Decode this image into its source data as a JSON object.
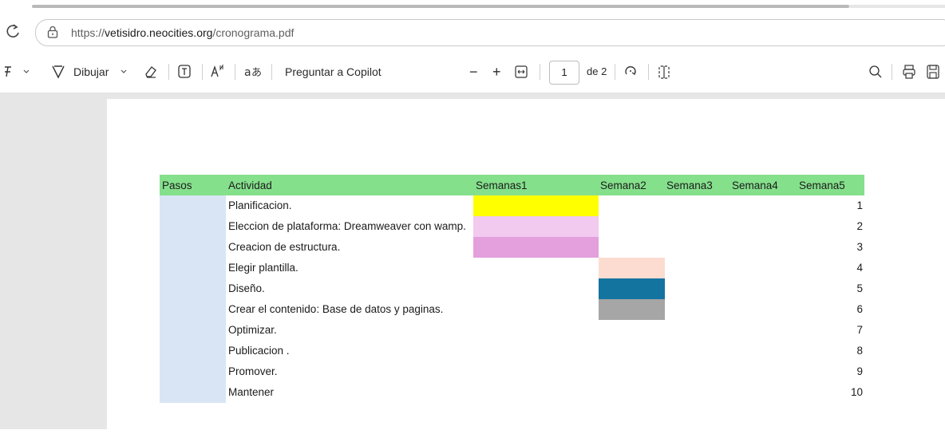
{
  "browser": {
    "url_prefix": "https://",
    "url_host": "vetisidro.neocities.org",
    "url_path": "/cronograma.pdf"
  },
  "toolbar": {
    "draw_label": "Dibujar",
    "copilot_label": "Preguntar a Copilot",
    "zoom_out": "−",
    "zoom_in": "+",
    "current_page": "1",
    "of_pages": "de 2"
  },
  "table": {
    "headers": {
      "steps": "Pasos",
      "activity": "Actividad",
      "week1": "Semanas1",
      "week2": "Semana2",
      "week3": "Semana3",
      "week4": "Semana4",
      "week5": "Semana5"
    },
    "rows": [
      {
        "n": "1",
        "activity": "Planificacion.",
        "bar_week": 1,
        "bar_color": "#ffff00"
      },
      {
        "n": "2",
        "activity": " Eleccion de plataforma: Dreamweaver con wamp.",
        "bar_week": 1,
        "bar_color": "#f2c9ef"
      },
      {
        "n": "3",
        "activity": "Creacion de estructura.",
        "bar_week": 1,
        "bar_color": "#e3a0dc"
      },
      {
        "n": "4",
        "activity": "Elegir plantilla.",
        "bar_week": 2,
        "bar_color": "#fcdcd0"
      },
      {
        "n": "5",
        "activity": "Diseño.",
        "bar_week": 2,
        "bar_color": "#1374a0"
      },
      {
        "n": "6",
        "activity": "Crear el contenido: Base de datos y paginas.",
        "bar_week": 2,
        "bar_color": "#a6a6a6"
      },
      {
        "n": "7",
        "activity": "Optimizar.",
        "bar_week": 0,
        "bar_color": ""
      },
      {
        "n": "8",
        "activity": "Publicacion .",
        "bar_week": 0,
        "bar_color": ""
      },
      {
        "n": "9",
        "activity": "Promover.",
        "bar_week": 0,
        "bar_color": ""
      },
      {
        "n": "10",
        "activity": "Mantener",
        "bar_week": 0,
        "bar_color": ""
      }
    ]
  },
  "colors": {
    "header_bg": "#85e08c",
    "steps_bg": "#d9e5f4",
    "viewer_bg": "#e6e6e6"
  }
}
